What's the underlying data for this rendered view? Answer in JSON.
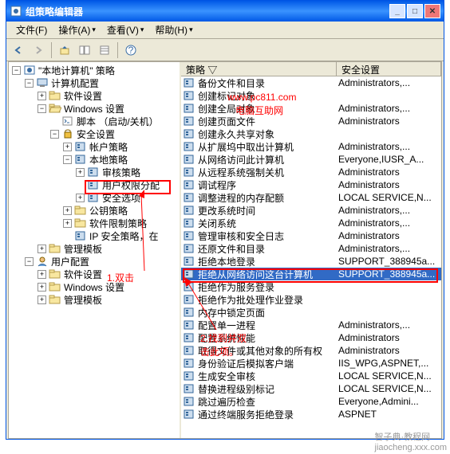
{
  "window": {
    "title": "组策略编辑器"
  },
  "menus": {
    "file": "文件(F)",
    "action": "操作(A)",
    "view": "查看(V)",
    "help": "帮助(H)"
  },
  "tree": {
    "root": "\"本地计算机\" 策略",
    "computer_config": "计算机配置",
    "software_settings": "软件设置",
    "windows_settings": "Windows 设置",
    "scripts": "脚本 （启动/关机）",
    "security_settings": "安全设置",
    "account_policy": "帐户策略",
    "local_policy": "本地策略",
    "audit_policy": "审核策略",
    "user_rights": "用户权限分配",
    "security_options": "安全选项",
    "public_key": "公钥策略",
    "restriction_policy": "软件限制策略",
    "ip_security": "IP 安全策略，在 ",
    "admin_templates": "管理模板",
    "user_config": "用户配置",
    "software_settings2": "软件设置",
    "windows_settings2": "Windows 设置",
    "admin_templates2": "管理模板"
  },
  "list_headers": {
    "policy": "策略  ▽",
    "setting": "安全设置"
  },
  "list": [
    {
      "name": "备份文件和目录",
      "setting": "Administrators,..."
    },
    {
      "name": "创建标记对象",
      "setting": ""
    },
    {
      "name": "创建全局对象",
      "setting": "Administrators,..."
    },
    {
      "name": "创建页面文件",
      "setting": "Administrators"
    },
    {
      "name": "创建永久共享对象",
      "setting": ""
    },
    {
      "name": "从扩展坞中取出计算机",
      "setting": "Administrators,..."
    },
    {
      "name": "从网络访问此计算机",
      "setting": "Everyone,IUSR_A..."
    },
    {
      "name": "从远程系统强制关机",
      "setting": "Administrators"
    },
    {
      "name": "调试程序",
      "setting": "Administrators"
    },
    {
      "name": "调整进程的内存配额",
      "setting": "LOCAL SERVICE,N..."
    },
    {
      "name": "更改系统时间",
      "setting": "Administrators,..."
    },
    {
      "name": "关闭系统",
      "setting": "Administrators,..."
    },
    {
      "name": "管理审核和安全日志",
      "setting": "Administrators"
    },
    {
      "name": "还原文件和目录",
      "setting": "Administrators,..."
    },
    {
      "name": "拒绝本地登录",
      "setting": "SUPPORT_388945a..."
    },
    {
      "name": "拒绝从网络访问这台计算机",
      "setting": "SUPPORT_388945a..."
    },
    {
      "name": "拒绝作为服务登录",
      "setting": ""
    },
    {
      "name": "拒绝作为批处理作业登录",
      "setting": ""
    },
    {
      "name": "内存中锁定页面",
      "setting": ""
    },
    {
      "name": "配置单一进程",
      "setting": "Administrators,..."
    },
    {
      "name": "配置系统性能",
      "setting": "Administrators"
    },
    {
      "name": "取得文件或其他对象的所有权",
      "setting": "Administrators"
    },
    {
      "name": "身份验证后模拟客户端",
      "setting": "IIS_WPG,ASPNET,..."
    },
    {
      "name": "生成安全审核",
      "setting": "LOCAL SERVICE,N..."
    },
    {
      "name": "替换进程级别标记",
      "setting": "LOCAL SERVICE,N..."
    },
    {
      "name": "跳过遍历检查",
      "setting": "Everyone,Admini..."
    },
    {
      "name": "通过终端服务拒绝登录",
      "setting": "ASPNET"
    }
  ],
  "selected_index": 15,
  "annotations": {
    "url": "www.pc811.com",
    "site": "电脑互助网",
    "step1": "1.双击",
    "step2": "2.找到并双\n击此项。"
  },
  "watermark": "智子典·教程网\njiaocheng.xxx.com"
}
